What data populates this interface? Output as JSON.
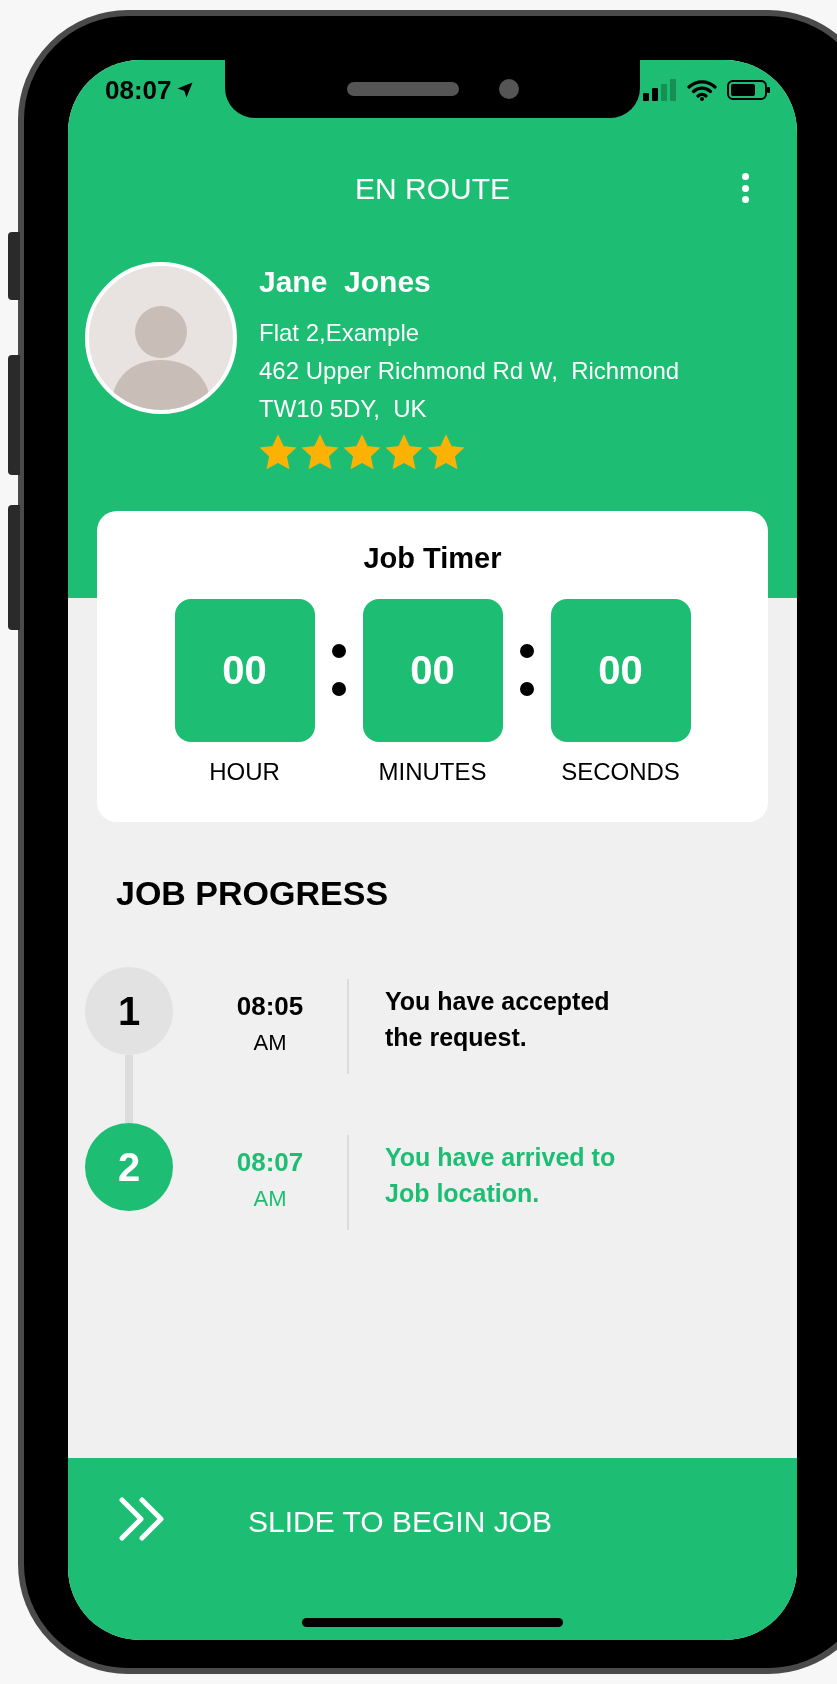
{
  "status_bar": {
    "time": "08:07"
  },
  "header": {
    "title": "EN ROUTE"
  },
  "customer": {
    "name": "Jane  Jones",
    "address_lines": [
      "Flat 2,Example",
      "462 Upper Richmond Rd W,  Richmond",
      "TW10 5DY,  UK"
    ],
    "stars": 5
  },
  "job_timer": {
    "title": "Job Timer",
    "units": [
      {
        "value": "00",
        "label": "HOUR"
      },
      {
        "value": "00",
        "label": "MINUTES"
      },
      {
        "value": "00",
        "label": "SECONDS"
      }
    ]
  },
  "job_progress": {
    "title": "JOB PROGRESS",
    "steps": [
      {
        "number": "1",
        "time": "08:05",
        "period": "AM",
        "text": "You have accepted the request.",
        "current": false
      },
      {
        "number": "2",
        "time": "08:07",
        "period": "AM",
        "text": "You have arrived to Job location.",
        "current": true
      }
    ]
  },
  "slide_button": {
    "label": "SLIDE TO BEGIN JOB"
  }
}
